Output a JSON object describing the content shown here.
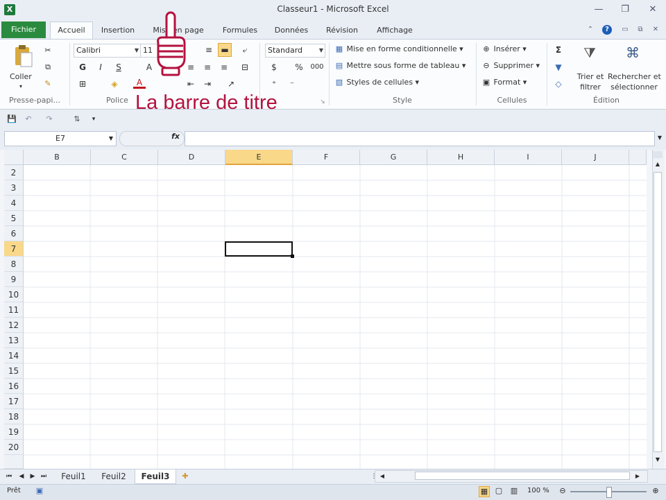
{
  "window": {
    "title": "Classeur1 - Microsoft Excel",
    "app_icon": "X"
  },
  "tabs": {
    "file": "Fichier",
    "items": [
      "Accueil",
      "Insertion",
      "Mise en page",
      "Formules",
      "Données",
      "Révision",
      "Affichage"
    ],
    "active": "Accueil"
  },
  "ribbon": {
    "clipboard": {
      "paste": "Coller",
      "group_label": "Presse-papi..."
    },
    "font": {
      "name": "Calibri",
      "size": "11",
      "bold": "G",
      "italic": "I",
      "underline": "S",
      "grow": "A",
      "color_a": "A",
      "group_label": "Police"
    },
    "number": {
      "format": "Standard",
      "percent": "%",
      "thousands": "000"
    },
    "styles": {
      "conditional": "Mise en forme conditionnelle",
      "table": "Mettre sous forme de tableau",
      "cell_styles": "Styles de cellules",
      "group_label": "Style"
    },
    "cells": {
      "insert": "Insérer",
      "delete": "Supprimer",
      "format": "Format",
      "group_label": "Cellules"
    },
    "editing": {
      "sigma": "Σ",
      "sort_line1": "Trier et",
      "sort_line2": "filtrer",
      "find_line1": "Rechercher et",
      "find_line2": "sélectionner",
      "group_label": "Édition"
    }
  },
  "annotation": {
    "text": "La barre de titre"
  },
  "formula_bar": {
    "name_box": "E7",
    "fx": "fx",
    "value": ""
  },
  "grid": {
    "columns": [
      "B",
      "C",
      "D",
      "E",
      "F",
      "G",
      "H",
      "I",
      "J"
    ],
    "rows": [
      "2",
      "3",
      "4",
      "5",
      "6",
      "7",
      "8",
      "9",
      "10",
      "11",
      "12",
      "13",
      "14",
      "15",
      "16",
      "17",
      "18",
      "19",
      "20"
    ],
    "selected_column": "E",
    "selected_row": "7"
  },
  "sheets": {
    "tabs": [
      "Feuil1",
      "Feuil2",
      "Feuil3"
    ],
    "active": "Feuil3"
  },
  "status": {
    "state": "Prêt",
    "zoom": "100 %"
  },
  "colors": {
    "file_tab": "#2a8a3e",
    "annotation": "#b3123f",
    "selection_header": "#f9d889"
  }
}
